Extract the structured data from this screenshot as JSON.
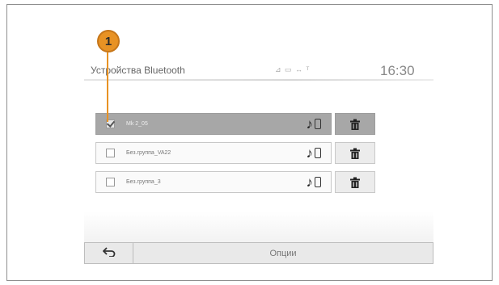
{
  "header": {
    "title": "Устройства Bluetooth",
    "status_icons": "⊿ ▭ ↔ ᵀ",
    "time": "16:30"
  },
  "callout": {
    "number": "1"
  },
  "devices": [
    {
      "name": "Mk 2_05",
      "checked": true,
      "selected": true
    },
    {
      "name": "Без.группа_VA22",
      "checked": false,
      "selected": false
    },
    {
      "name": "Без.группа_3",
      "checked": false,
      "selected": false
    }
  ],
  "footer": {
    "back_icon": "back-arrow-icon",
    "options_label": "Опции"
  }
}
